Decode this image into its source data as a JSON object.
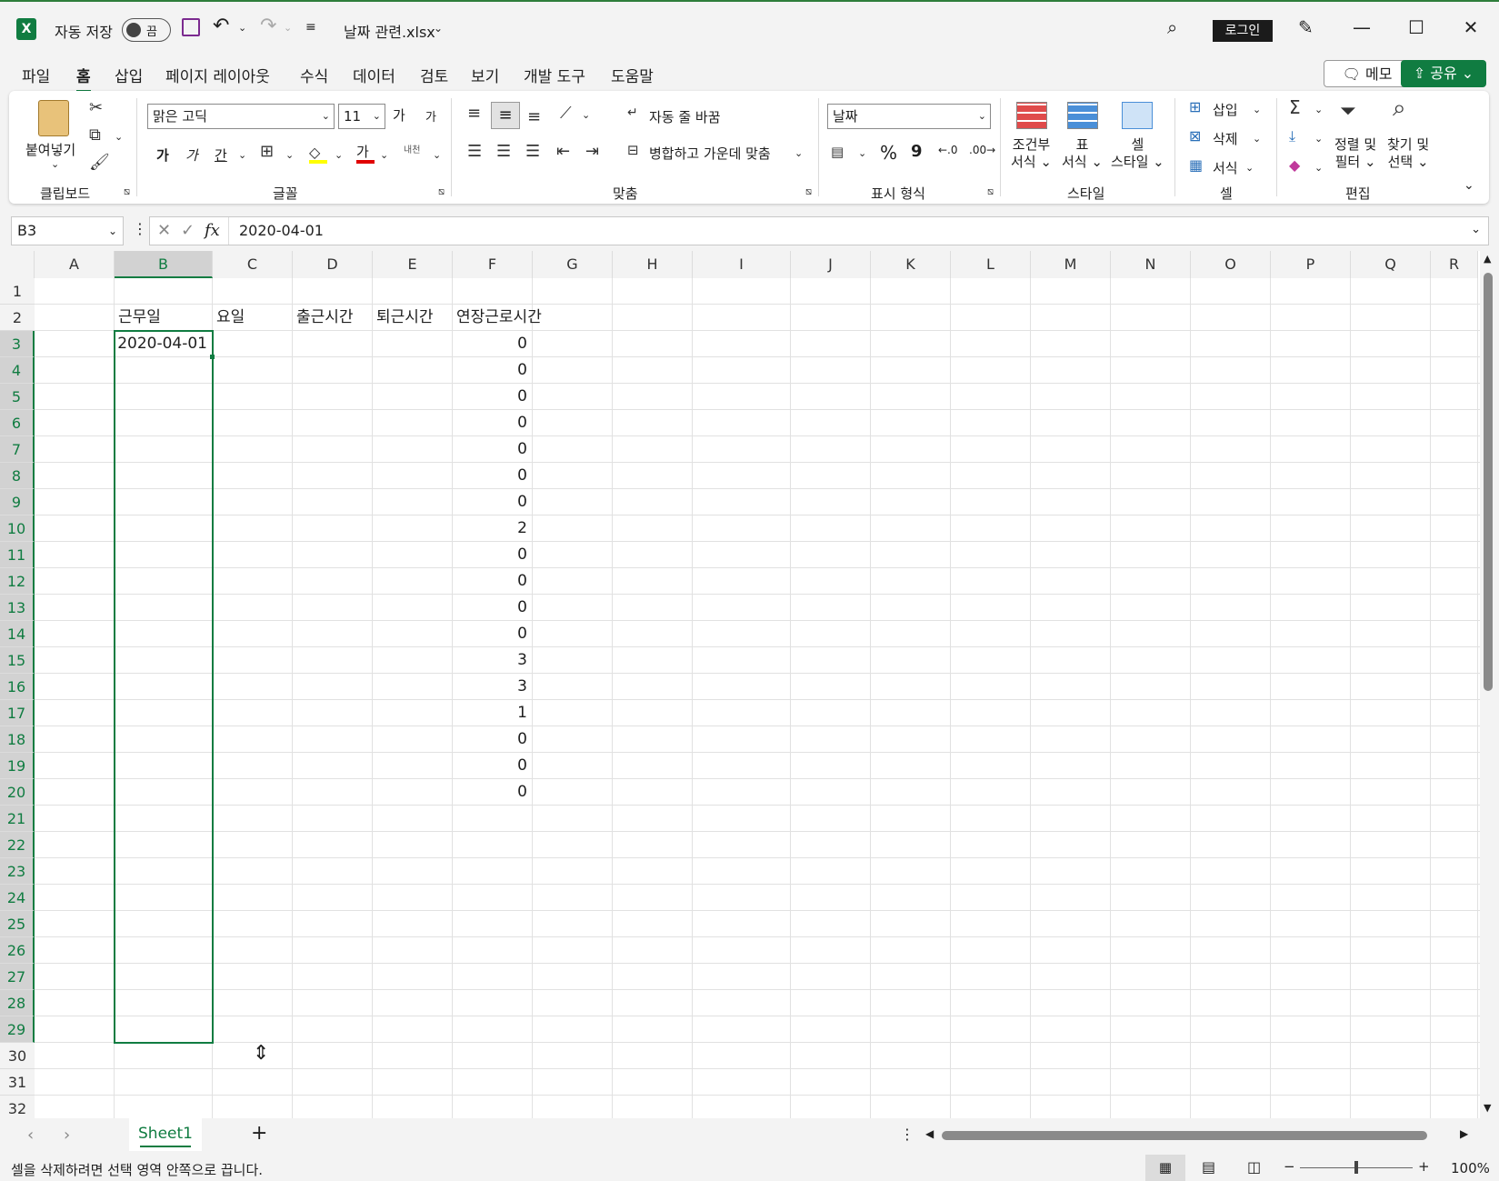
{
  "title_bar": {
    "autosave_label": "자동 저장",
    "autosave_state": "끔",
    "filename": "날짜 관련.xlsx",
    "login_label": "로그인"
  },
  "menu": {
    "tabs": [
      "파일",
      "홈",
      "삽입",
      "페이지 레이아웃",
      "수식",
      "데이터",
      "검토",
      "보기",
      "개발 도구",
      "도움말"
    ],
    "active": "홈",
    "memo_label": "메모",
    "share_label": "공유"
  },
  "ribbon": {
    "paste_label": "붙여넣기",
    "clipboard_group": "클립보드",
    "font_name": "맑은 고딕",
    "font_size": "11",
    "font_group": "글꼴",
    "bold": "가",
    "italic": "가",
    "underline": "간",
    "font_color": "가",
    "phonetic": "내천",
    "grow_font": "가",
    "shrink_font": "가",
    "wrap_text": "자동 줄 바꿈",
    "merge_center": "병합하고 가운데 맞춤",
    "align_group": "맞춤",
    "number_format": "날짜",
    "number_group": "표시 형식",
    "percent": "%",
    "comma": "9",
    "conditional_format": [
      "조건부",
      "서식"
    ],
    "format_table": [
      "표",
      "서식"
    ],
    "cell_style": [
      "셀",
      "스타일"
    ],
    "style_group": "스타일",
    "insert_label": "삽입",
    "delete_label": "삭제",
    "format_label": "서식",
    "cells_group": "셀",
    "sort_filter": [
      "정렬 및",
      "필터"
    ],
    "find_select": [
      "찾기 및",
      "선택"
    ],
    "editing_group": "편집"
  },
  "formula_bar": {
    "name_box": "B3",
    "fx": "fx",
    "formula": "2020-04-01"
  },
  "sheet": {
    "columns": [
      "A",
      "B",
      "C",
      "D",
      "E",
      "F",
      "G",
      "H",
      "I",
      "J",
      "K",
      "L",
      "M",
      "N",
      "O",
      "P",
      "Q",
      "R"
    ],
    "row_numbers": [
      "1",
      "2",
      "3",
      "4",
      "5",
      "6",
      "7",
      "8",
      "9",
      "10",
      "11",
      "12",
      "13",
      "14",
      "15",
      "16",
      "17",
      "18",
      "19",
      "20",
      "21",
      "22",
      "23",
      "24",
      "25",
      "26",
      "27",
      "28",
      "29",
      "30",
      "31",
      "32"
    ],
    "headers": {
      "B": "근무일",
      "C": "요일",
      "D": "출근시간",
      "E": "퇴근시간",
      "F": "연장근로시간"
    },
    "b3_value": "2020-04-01",
    "f_values": [
      "0",
      "0",
      "0",
      "0",
      "0",
      "0",
      "0",
      "2",
      "0",
      "0",
      "0",
      "0",
      "3",
      "3",
      "1",
      "0",
      "0",
      "0"
    ],
    "selected_range": "B3:B29"
  },
  "tabs": {
    "sheet_name": "Sheet1",
    "add_label": "+"
  },
  "status": {
    "message": "셀을 삭제하려면 선택 영역 안쪽으로 끕니다.",
    "zoom": "100%",
    "zoom_level_percent": 100
  },
  "colors": {
    "accent": "#107c41",
    "selection": "#107c41"
  }
}
